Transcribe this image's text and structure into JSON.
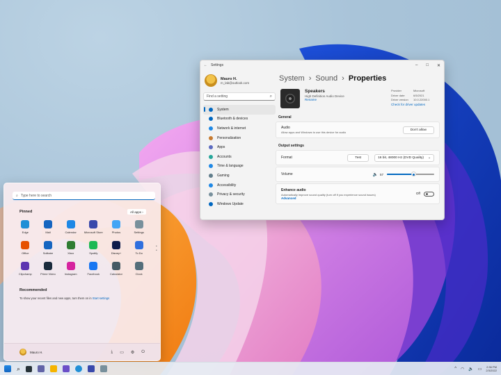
{
  "settings": {
    "title": "Settings",
    "user": {
      "name": "Mauro H.",
      "email": "m_lab@outlook.com"
    },
    "search_placeholder": "Find a setting",
    "nav": [
      {
        "label": "System",
        "icon": "monitor-icon",
        "color": "#0067c0"
      },
      {
        "label": "Bluetooth & devices",
        "icon": "bluetooth-icon",
        "color": "#0067c0"
      },
      {
        "label": "Network & internet",
        "icon": "wifi-icon",
        "color": "#1e88e5"
      },
      {
        "label": "Personalization",
        "icon": "brush-icon",
        "color": "#c77b30"
      },
      {
        "label": "Apps",
        "icon": "apps-icon",
        "color": "#5c6bc0"
      },
      {
        "label": "Accounts",
        "icon": "person-icon",
        "color": "#26a69a"
      },
      {
        "label": "Time & language",
        "icon": "globe-clock-icon",
        "color": "#1e88e5"
      },
      {
        "label": "Gaming",
        "icon": "gamepad-icon",
        "color": "#607d8b"
      },
      {
        "label": "Accessibility",
        "icon": "accessibility-icon",
        "color": "#1e88e5"
      },
      {
        "label": "Privacy & security",
        "icon": "shield-icon",
        "color": "#78909c"
      },
      {
        "label": "Windows Update",
        "icon": "update-icon",
        "color": "#0067c0"
      }
    ],
    "breadcrumb": [
      "System",
      "Sound",
      "Properties"
    ],
    "device": {
      "name": "Speakers",
      "subtitle": "High Definition Audio Device",
      "rename": "Rename",
      "info": [
        {
          "k": "Provider",
          "v": "Microsoft"
        },
        {
          "k": "Driver date",
          "v": "6/5/2021"
        },
        {
          "k": "Driver version",
          "v": "10.0.22000.1"
        }
      ],
      "driver_link": "Check for driver updates"
    },
    "general": {
      "heading": "General",
      "audio_title": "Audio",
      "audio_desc": "Allow apps and Windows to use this device for audio",
      "dont_allow": "Don't allow"
    },
    "output": {
      "heading": "Output settings",
      "format_label": "Format",
      "test": "Test",
      "format_value": "16 bit, 48000 Hz (DVD Quality)",
      "volume_label": "Volume",
      "volume_value": "57",
      "volume_fraction": 0.57,
      "enhance_title": "Enhance audio",
      "enhance_desc": "Automatically improve sound quality (turn off if you experience sound issues)",
      "advanced": "Advanced",
      "enhance_state": "Off"
    }
  },
  "start": {
    "search_placeholder": "Type here to search",
    "pinned_heading": "Pinned",
    "all_apps": "All apps",
    "apps": [
      {
        "label": "Edge",
        "color": "#1f8fd6"
      },
      {
        "label": "Mail",
        "color": "#1565c0"
      },
      {
        "label": "Calendar",
        "color": "#1e88e5"
      },
      {
        "label": "Microsoft Store",
        "color": "#3949ab"
      },
      {
        "label": "Photos",
        "color": "#42a5f5"
      },
      {
        "label": "Settings",
        "color": "#78909c"
      },
      {
        "label": "Office",
        "color": "#e65100"
      },
      {
        "label": "Solitaire",
        "color": "#1565c0"
      },
      {
        "label": "Xbox",
        "color": "#2e7d32"
      },
      {
        "label": "Spotify",
        "color": "#1db954"
      },
      {
        "label": "Disney+",
        "color": "#0d1b4a"
      },
      {
        "label": "To Do",
        "color": "#2f6fde"
      },
      {
        "label": "Clipchamp",
        "color": "#5e35b1"
      },
      {
        "label": "Prime Video",
        "color": "#1a2b3c"
      },
      {
        "label": "Instagram",
        "color": "#d6249f"
      },
      {
        "label": "Facebook",
        "color": "#1877f2"
      },
      {
        "label": "Calculator",
        "color": "#455a64"
      },
      {
        "label": "Clock",
        "color": "#546e7a"
      }
    ],
    "recommended_heading": "Recommended",
    "recommended_text": "To show your recent files and new apps, turn them on in",
    "recommended_link": "Start settings",
    "user": "Mauro H."
  },
  "taskbar": {
    "time": "2:36 PM",
    "date": "2/3/2022"
  }
}
